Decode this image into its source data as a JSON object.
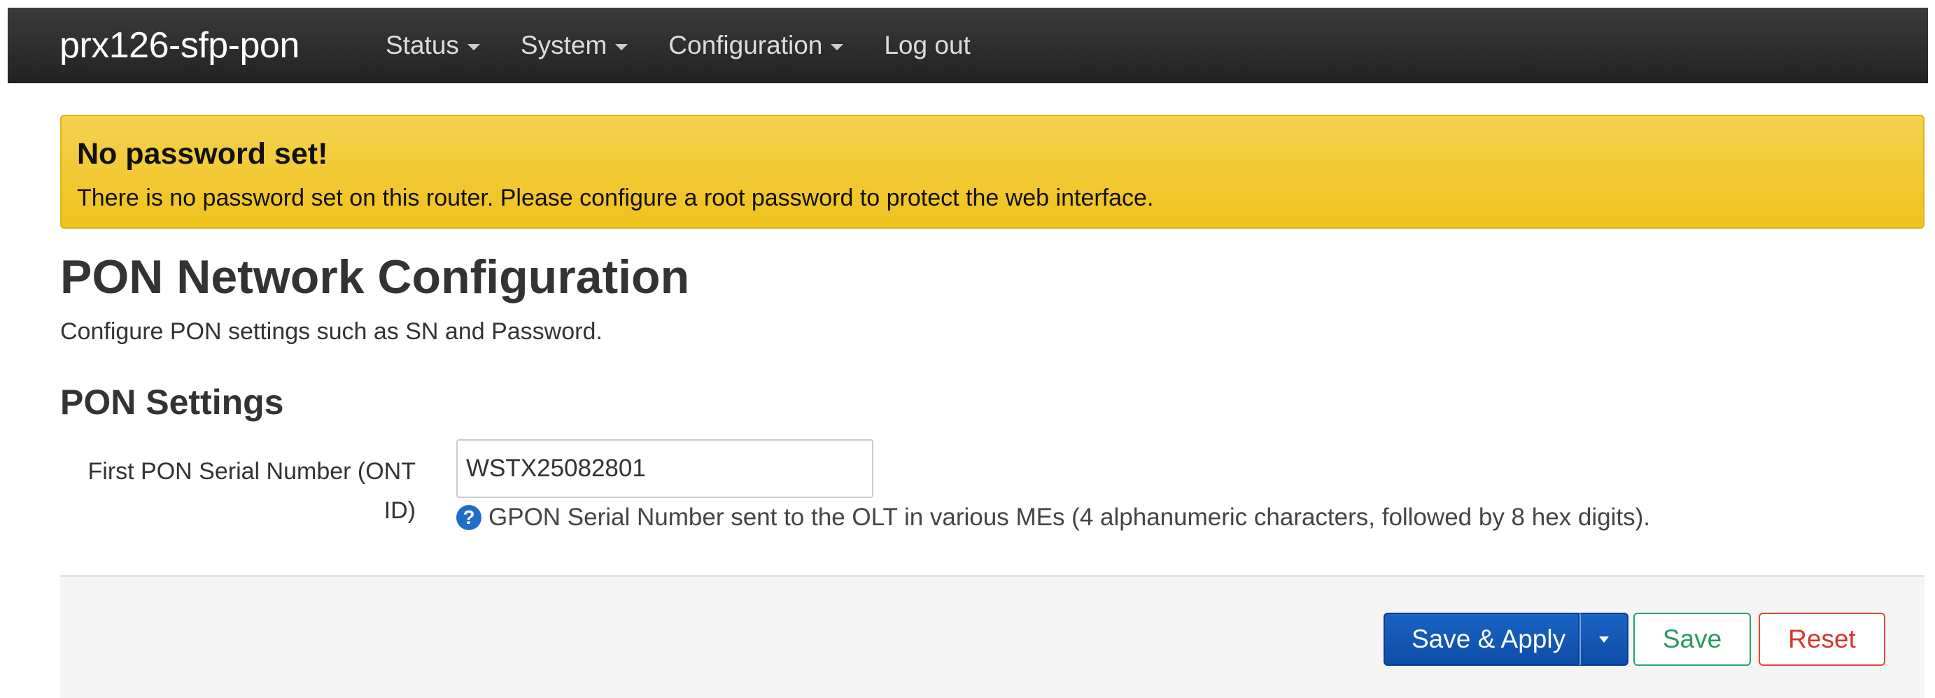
{
  "navbar": {
    "brand": "prx126-sfp-pon",
    "items": [
      {
        "label": "Status",
        "has_dropdown": true
      },
      {
        "label": "System",
        "has_dropdown": true
      },
      {
        "label": "Configuration",
        "has_dropdown": true
      },
      {
        "label": "Log out",
        "has_dropdown": false
      }
    ]
  },
  "alert": {
    "title": "No password set!",
    "message": "There is no password set on this router. Please configure a root password to protect the web interface.",
    "color": "#f0c21d"
  },
  "page": {
    "title": "PON Network Configuration",
    "description": "Configure PON settings such as SN and Password."
  },
  "section": {
    "title": "PON Settings",
    "fields": [
      {
        "label": "First PON Serial Number (ONT ID)",
        "value": "WSTX25082801",
        "help_icon": "question-circle-icon",
        "help_text": "GPON Serial Number sent to the OLT in various MEs (4 alphanumeric characters, followed by 8 hex digits)."
      }
    ]
  },
  "actions": {
    "save_apply_label": "Save & Apply",
    "save_label": "Save",
    "reset_label": "Reset",
    "primary_color": "#0d4da6",
    "save_color": "#2aa36b",
    "reset_color": "#e0463c"
  }
}
